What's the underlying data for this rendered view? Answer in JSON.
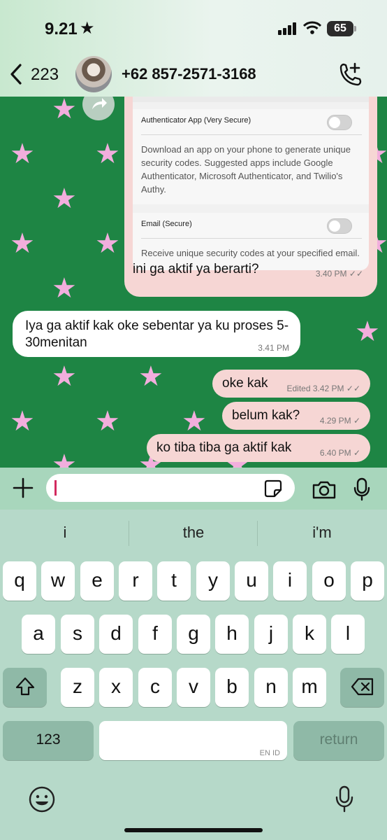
{
  "status_bar": {
    "time": "9.21",
    "battery": "65"
  },
  "header": {
    "back_count": "223",
    "contact": "+62 857-2571-3168"
  },
  "screenshot_attachment": {
    "option1_title": "Authenticator App (Very Secure)",
    "option1_body": "Download an app on your phone to generate unique security codes. Suggested apps include Google Authenticator, Microsoft Authenticator, and Twilio's Authy.",
    "option2_title": "Email (Secure)",
    "option2_body": "Receive unique security codes at your specified email."
  },
  "messages": [
    {
      "dir": "out",
      "text": "ini ga aktif ya berarti?",
      "meta": "3.40 PM ✓✓"
    },
    {
      "dir": "in",
      "text": "Iya ga aktif kak oke sebentar ya ku proses 5-30menitan",
      "meta": "3.41 PM"
    },
    {
      "dir": "out",
      "text": "oke kak",
      "meta": "Edited 3.42 PM ✓✓"
    },
    {
      "dir": "out",
      "text": "belum kak?",
      "meta": "4.29 PM ✓"
    },
    {
      "dir": "out",
      "text": "ko tiba tiba ga aktif kak",
      "meta": "6.40 PM ✓"
    }
  ],
  "keyboard": {
    "suggestions": [
      "i",
      "the",
      "i'm"
    ],
    "row1": [
      "q",
      "w",
      "e",
      "r",
      "t",
      "y",
      "u",
      "i",
      "o",
      "p"
    ],
    "row2": [
      "a",
      "s",
      "d",
      "f",
      "g",
      "h",
      "j",
      "k",
      "l"
    ],
    "row3": [
      "z",
      "x",
      "c",
      "v",
      "b",
      "n",
      "m"
    ],
    "numbers_label": "123",
    "return_label": "return",
    "lang_label": "EN ID"
  },
  "colors": {
    "chat_bg": "#1e8544",
    "star": "#f2aedd",
    "outgoing": "#f6d6d4",
    "incoming": "#ffffff",
    "caret": "#d22a5f"
  },
  "icons": [
    "back-chevron-icon",
    "add-call-icon",
    "share-icon",
    "plus-icon",
    "sticker-icon",
    "camera-icon",
    "microphone-icon",
    "shift-icon",
    "backspace-icon",
    "emoji-icon"
  ]
}
